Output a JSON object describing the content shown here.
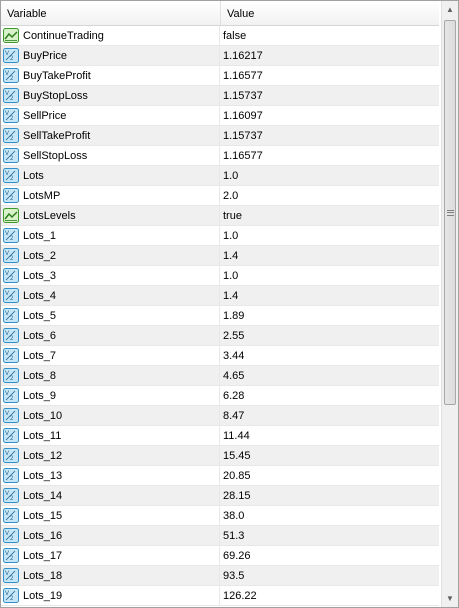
{
  "header": {
    "variable_label": "Variable",
    "value_label": "Value"
  },
  "rows": [
    {
      "name": "ContinueTrading",
      "value": "false",
      "icon": "bool-icon"
    },
    {
      "name": "BuyPrice",
      "value": "1.16217",
      "icon": "number-icon"
    },
    {
      "name": "BuyTakeProfit",
      "value": "1.16577",
      "icon": "number-icon"
    },
    {
      "name": "BuyStopLoss",
      "value": "1.15737",
      "icon": "number-icon"
    },
    {
      "name": "SellPrice",
      "value": "1.16097",
      "icon": "number-icon"
    },
    {
      "name": "SellTakeProfit",
      "value": "1.15737",
      "icon": "number-icon"
    },
    {
      "name": "SellStopLoss",
      "value": "1.16577",
      "icon": "number-icon"
    },
    {
      "name": "Lots",
      "value": "1.0",
      "icon": "number-icon"
    },
    {
      "name": "LotsMP",
      "value": "2.0",
      "icon": "number-icon"
    },
    {
      "name": "LotsLevels",
      "value": "true",
      "icon": "bool-icon"
    },
    {
      "name": "Lots_1",
      "value": "1.0",
      "icon": "number-icon"
    },
    {
      "name": "Lots_2",
      "value": "1.4",
      "icon": "number-icon"
    },
    {
      "name": "Lots_3",
      "value": "1.0",
      "icon": "number-icon"
    },
    {
      "name": "Lots_4",
      "value": "1.4",
      "icon": "number-icon"
    },
    {
      "name": "Lots_5",
      "value": "1.89",
      "icon": "number-icon"
    },
    {
      "name": "Lots_6",
      "value": "2.55",
      "icon": "number-icon"
    },
    {
      "name": "Lots_7",
      "value": "3.44",
      "icon": "number-icon"
    },
    {
      "name": "Lots_8",
      "value": "4.65",
      "icon": "number-icon"
    },
    {
      "name": "Lots_9",
      "value": "6.28",
      "icon": "number-icon"
    },
    {
      "name": "Lots_10",
      "value": "8.47",
      "icon": "number-icon"
    },
    {
      "name": "Lots_11",
      "value": "11.44",
      "icon": "number-icon"
    },
    {
      "name": "Lots_12",
      "value": "15.45",
      "icon": "number-icon"
    },
    {
      "name": "Lots_13",
      "value": "20.85",
      "icon": "number-icon"
    },
    {
      "name": "Lots_14",
      "value": "28.15",
      "icon": "number-icon"
    },
    {
      "name": "Lots_15",
      "value": "38.0",
      "icon": "number-icon"
    },
    {
      "name": "Lots_16",
      "value": "51.3",
      "icon": "number-icon"
    },
    {
      "name": "Lots_17",
      "value": "69.26",
      "icon": "number-icon"
    },
    {
      "name": "Lots_18",
      "value": "93.5",
      "icon": "number-icon"
    },
    {
      "name": "Lots_19",
      "value": "126.22",
      "icon": "number-icon"
    }
  ],
  "colors": {
    "number_icon_bg": "#c6e6f7",
    "number_icon_border": "#2f8fc9",
    "bool_icon_bg": "#d7f2c8",
    "bool_icon_border": "#3c9a2a",
    "alt_row": "#f0f0f0"
  }
}
